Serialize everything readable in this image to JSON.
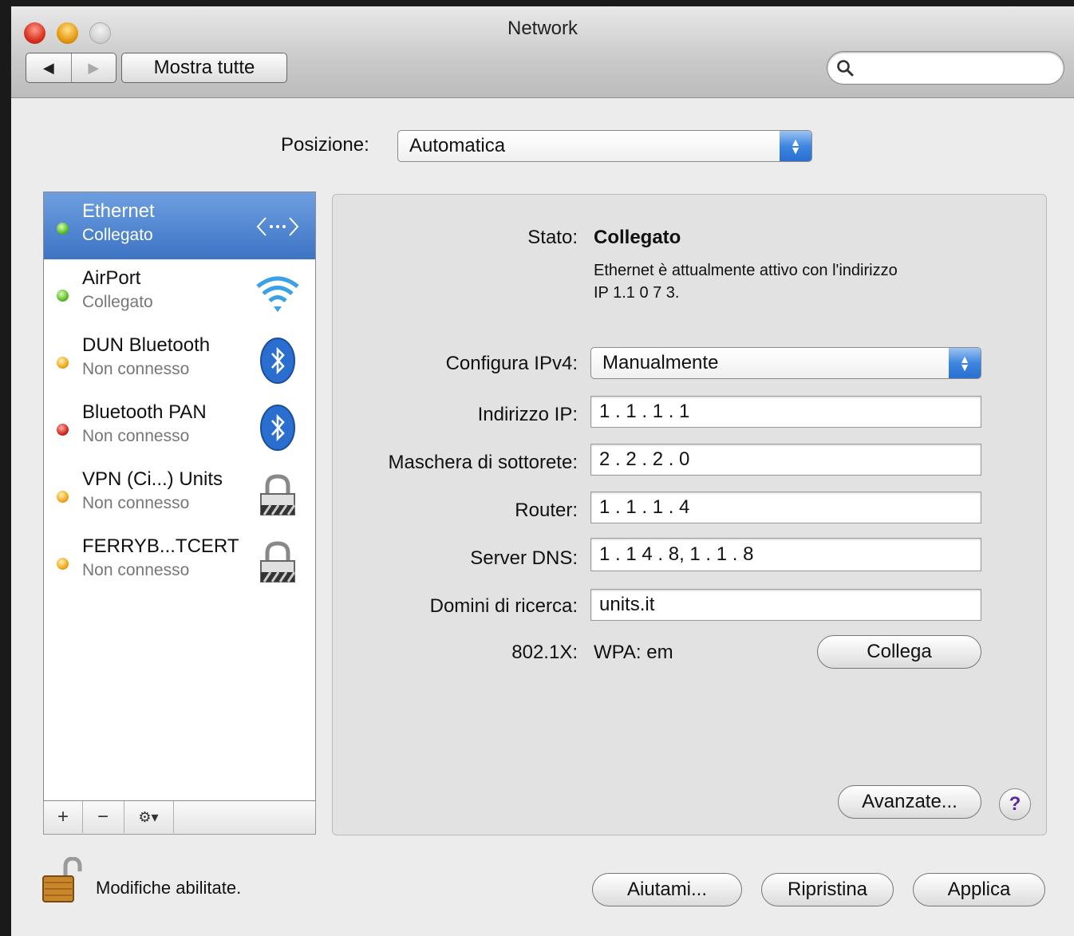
{
  "window": {
    "title": "Network"
  },
  "toolbar": {
    "back": "◀",
    "forward": "▶",
    "show_all": "Mostra tutte",
    "search_placeholder": ""
  },
  "location": {
    "label": "Posizione:",
    "value": "Automatica"
  },
  "services": [
    {
      "name": "Ethernet",
      "status": "Collegato",
      "dot": "green",
      "icon": "ethernet-icon"
    },
    {
      "name": "AirPort",
      "status": "Collegato",
      "dot": "green",
      "icon": "wifi-icon"
    },
    {
      "name": "DUN Bluetooth",
      "status": "Non connesso",
      "dot": "yellow",
      "icon": "bluetooth-icon"
    },
    {
      "name": "Bluetooth PAN",
      "status": "Non connesso",
      "dot": "red",
      "icon": "bluetooth-icon"
    },
    {
      "name": "VPN (Ci...) Units",
      "status": "Non connesso",
      "dot": "yellow",
      "icon": "vpn-lock-icon"
    },
    {
      "name": "FERRYB...TCERT",
      "status": "Non connesso",
      "dot": "yellow",
      "icon": "vpn-lock-icon"
    }
  ],
  "sidebar_buttons": {
    "add": "+",
    "remove": "−",
    "action": "⚙▾"
  },
  "detail": {
    "status_label": "Stato:",
    "status_value": "Collegato",
    "status_desc_line1": "Ethernet è attualmente attivo con l'indirizzo",
    "status_desc_line2": "IP 1.1 0 7 3.",
    "configure_label": "Configura IPv4:",
    "configure_value": "Manualmente",
    "ip_label": "Indirizzo IP:",
    "ip_value": "1 . 1 . 1 . 1",
    "subnet_label": "Maschera di sottorete:",
    "subnet_value": "2 . 2 . 2 . 0",
    "router_label": "Router:",
    "router_value": "1 . 1 . 1 . 4",
    "dns_label": "Server DNS:",
    "dns_value": "1 . 1 4 . 8, 1 . 1 . 8",
    "search_domains_label": "Domini di ricerca:",
    "search_domains_value": "units.it",
    "dot1x_label": "802.1X:",
    "dot1x_value": "WPA: em",
    "connect_button": "Collega",
    "advanced_button": "Avanzate...",
    "help_button": "?"
  },
  "footer": {
    "lock_text": "Modifiche abilitate.",
    "assist_button": "Aiutami...",
    "revert_button": "Ripristina",
    "apply_button": "Applica"
  },
  "colors": {
    "selection": "#3c73c4",
    "dot_green": "#5bbc2a",
    "dot_yellow": "#f0a81c",
    "dot_red": "#d0281c",
    "bluetooth": "#2a6fd0"
  }
}
